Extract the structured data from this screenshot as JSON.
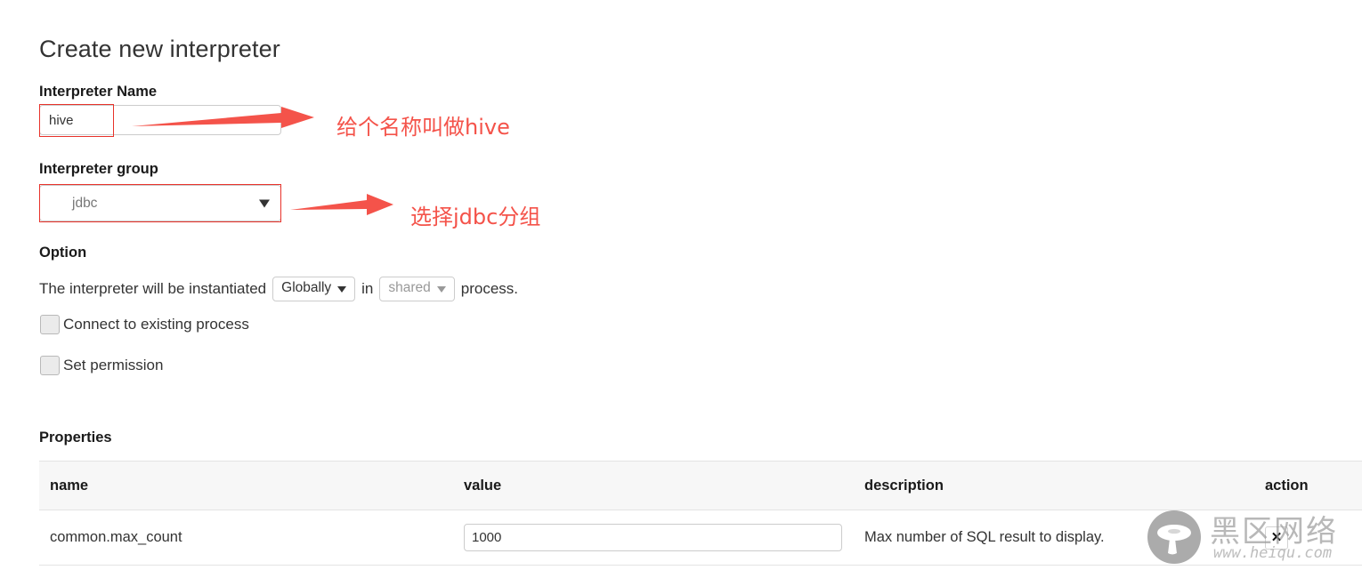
{
  "page": {
    "title": "Create new interpreter"
  },
  "interpreter_name": {
    "label": "Interpreter Name",
    "value": "hive",
    "placeholder": ""
  },
  "interpreter_group": {
    "label": "Interpreter group",
    "selected": "jdbc"
  },
  "option": {
    "label": "Option",
    "sentence_prefix": "The interpreter will be instantiated",
    "scope_selected": "Globally",
    "sentence_middle": "in",
    "process_selected": "shared",
    "sentence_suffix": "process.",
    "checkboxes": [
      {
        "label": "Connect to existing process",
        "checked": false
      },
      {
        "label": "Set permission",
        "checked": false
      }
    ]
  },
  "properties": {
    "label": "Properties",
    "columns": [
      "name",
      "value",
      "description",
      "action"
    ],
    "rows": [
      {
        "name": "common.max_count",
        "value": "1000",
        "description": "Max number of SQL result to display.",
        "action_label": "✕"
      }
    ]
  },
  "annotations": [
    {
      "text": "给个名称叫做hive"
    },
    {
      "text": "选择jdbc分组"
    }
  ],
  "watermark": {
    "cn": "黑区网络",
    "url": "www.heiqu.com"
  },
  "colors": {
    "annotation_red": "#f4534a",
    "annotation_box": "#e8322a",
    "border_gray": "#cccccc",
    "table_header_bg": "#f7f7f7"
  }
}
